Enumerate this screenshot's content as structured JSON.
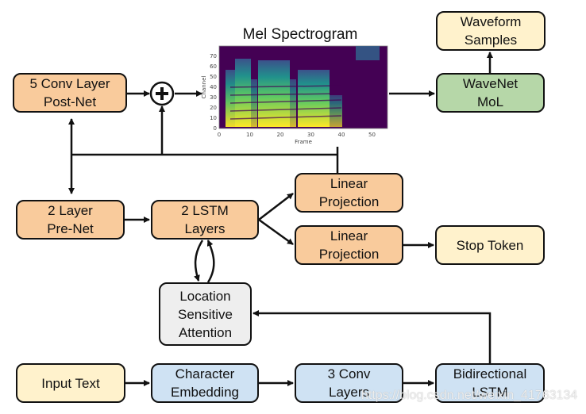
{
  "boxes": {
    "waveform": "Waveform\nSamples",
    "wavenet": "WaveNet\nMoL",
    "postnet": "5 Conv Layer\nPost-Net",
    "prenet": "2 Layer\nPre-Net",
    "lstm": "2 LSTM\nLayers",
    "linear1": "Linear\nProjection",
    "linear2": "Linear\nProjection",
    "stop": "Stop Token",
    "attention": "Location\nSensitive\nAttention",
    "input": "Input Text",
    "embedding": "Character\nEmbedding",
    "conv": "3 Conv\nLayers",
    "bilstm": "Bidirectional\nLSTM"
  },
  "spectrogram": {
    "title": "Mel Spectrogram",
    "xlabel": "Frame",
    "ylabel": "Channel",
    "xticks": [
      "0",
      "10",
      "20",
      "30",
      "40",
      "50"
    ],
    "yticks": [
      "0",
      "10",
      "20",
      "30",
      "40",
      "50",
      "60",
      "70"
    ]
  },
  "colors": {
    "orange": "#f9cb9c",
    "yellow": "#fff2cc",
    "green": "#b6d7a8",
    "blue": "#cfe2f3",
    "grey": "#eeeeee"
  },
  "watermark": "https://blog.csdn.net/weixin_41763134"
}
